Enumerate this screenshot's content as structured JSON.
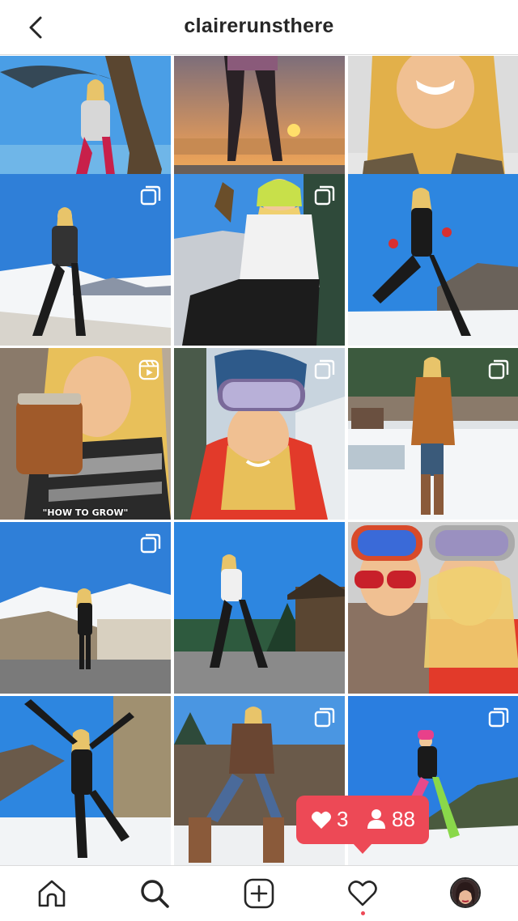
{
  "header": {
    "username": "clairerunsthere"
  },
  "icons": {
    "back": "chevron-left-icon",
    "multi_post": "multiple-photos-icon",
    "reel": "reel-icon",
    "home": "home-icon",
    "search": "search-icon",
    "add": "add-post-icon",
    "activity": "heart-icon",
    "profile": "avatar"
  },
  "grid": {
    "posts": [
      {
        "badge": "",
        "caption": ""
      },
      {
        "badge": "",
        "caption": ""
      },
      {
        "badge": "",
        "caption": ""
      },
      {
        "badge": "multi",
        "caption": ""
      },
      {
        "badge": "multi",
        "caption": ""
      },
      {
        "badge": "",
        "caption": ""
      },
      {
        "badge": "reel",
        "caption": "\"HOW TO GROW\""
      },
      {
        "badge": "multi",
        "caption": ""
      },
      {
        "badge": "multi",
        "caption": ""
      },
      {
        "badge": "multi",
        "caption": ""
      },
      {
        "badge": "",
        "caption": ""
      },
      {
        "badge": "",
        "caption": ""
      },
      {
        "badge": "",
        "caption": ""
      },
      {
        "badge": "multi",
        "caption": ""
      },
      {
        "badge": "multi",
        "caption": ""
      }
    ]
  },
  "notification": {
    "likes": "3",
    "follows": "88"
  },
  "colors": {
    "accent": "#ed4956",
    "text": "#262626",
    "divider": "#dbdbdb"
  }
}
